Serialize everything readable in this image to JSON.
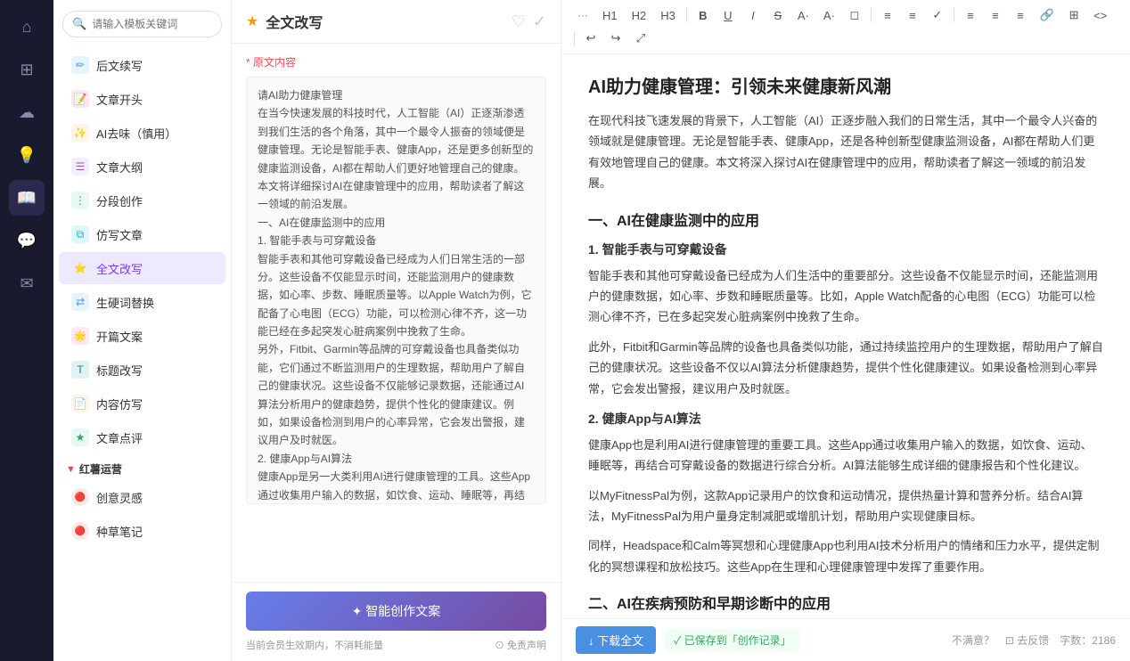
{
  "sidebar": {
    "icons": [
      {
        "name": "home",
        "symbol": "⌂",
        "active": false
      },
      {
        "name": "template",
        "symbol": "⊞",
        "active": false
      },
      {
        "name": "cloud",
        "symbol": "☁",
        "active": false
      },
      {
        "name": "bulb",
        "symbol": "💡",
        "active": false
      },
      {
        "name": "book",
        "symbol": "📖",
        "active": true
      },
      {
        "name": "chat",
        "symbol": "💬",
        "active": false
      },
      {
        "name": "mail",
        "symbol": "✉",
        "active": false
      }
    ]
  },
  "search": {
    "placeholder": "请输入模板关键词"
  },
  "nav_items": [
    {
      "label": "后文续写",
      "color": "dot-blue",
      "active": false
    },
    {
      "label": "文章开头",
      "color": "dot-red",
      "active": false
    },
    {
      "label": "AI去味（慎用）",
      "color": "dot-orange",
      "active": false
    },
    {
      "label": "文章大纲",
      "color": "dot-purple",
      "active": false
    },
    {
      "label": "分段创作",
      "color": "dot-green",
      "active": false
    },
    {
      "label": "仿写文章",
      "color": "dot-cyan",
      "active": false
    },
    {
      "label": "全文改写",
      "color": "dot-purple",
      "active": true
    },
    {
      "label": "生硬词替换",
      "color": "dot-blue",
      "active": false
    },
    {
      "label": "开篇文案",
      "color": "dot-pink",
      "active": false
    },
    {
      "label": "标题改写",
      "color": "dot-teal",
      "active": false
    },
    {
      "label": "内容仿写",
      "color": "dot-orange",
      "active": false
    },
    {
      "label": "文章点评",
      "color": "dot-green",
      "active": false
    }
  ],
  "section": {
    "label": "红薯运营",
    "sub_items": [
      {
        "label": "创意灵感",
        "color": "dot-red"
      },
      {
        "label": "种草笔记",
        "color": "dot-red"
      }
    ]
  },
  "middle": {
    "title": "全文改写",
    "original_label": "* 原文内容",
    "original_text": "请AI助力健康管理\n在当今快速发展的科技时代，人工智能（AI）正逐渐渗透到我们生活的各个角落，其中一个最令人振奋的领域便是健康管理。无论是智能手表、健康App，还是更多创新型的健康监测设备，AI都在帮助人们更好地管理自己的健康。本文将详细探讨AI在健康管理中的应用，帮助读者了解这一领域的前沿发展。\n一、AI在健康监测中的应用\n1. 智能手表与可穿戴设备\n智能手表和其他可穿戴设备已经成为人们日常生活的一部分。这些设备不仅能显示时间，还能监测用户的健康数据，如心率、步数、睡眠质量等。以Apple Watch为例，它配备了心电图（ECG）功能，可以检测心律不齐，这一功能已经在多起突发心脏病案例中挽救了生命。\n另外，Fitbit、Garmin等品牌的可穿戴设备也具备类似功能，它们通过不断监测用户的生理数据，帮助用户了解自己的健康状况。这些设备不仅能够记录数据，还能通过AI算法分析用户的健康趋势，提供个性化的健康建议。例如，如果设备检测到用户的心率异常，它会发出警报，建议用户及时就医。\n2. 健康App与AI算法\n健康App是另一大类利用AI进行健康管理的工具。这些App通过收集用户输入的数据，如饮食、运动、睡眠等，再结合可穿戴设备的数据进行综合分析。AI算法能够分析这些数据，生成详细的健康报告和个性化建议。",
    "smart_btn_label": "✦ 智能创作文案",
    "footer_note_left": "当前会员生效期内，不消耗能量",
    "footer_note_right": "⊙ 免责声明"
  },
  "editor": {
    "title": "AI助力健康管理：引领未来健康新风潮",
    "toolbar": {
      "buttons": [
        "",
        "H1",
        "H2",
        "H3",
        "B",
        "U",
        "I",
        "S",
        "A·",
        "A·",
        "◻",
        "≡",
        "≡",
        "✓"
      ],
      "buttons2": [
        "≡",
        "≡",
        "≡",
        "🔗",
        "⊞",
        "<>",
        "↩",
        "↪",
        "⤢"
      ]
    },
    "sections": [
      {
        "type": "p",
        "text": "在现代科技飞速发展的背景下，人工智能（AI）正逐步融入我们的日常生活，其中一个最令人兴奋的领域就是健康管理。无论是智能手表、健康App，还是各种创新型健康监测设备，AI都在帮助人们更有效地管理自己的健康。本文将深入探讨AI在健康管理中的应用，帮助读者了解这一领域的前沿发展。"
      },
      {
        "type": "h2",
        "text": "一、AI在健康监测中的应用"
      },
      {
        "type": "h3",
        "text": "1. 智能手表与可穿戴设备"
      },
      {
        "type": "p",
        "text": "智能手表和其他可穿戴设备已经成为人们生活中的重要部分。这些设备不仅能显示时间，还能监测用户的健康数据，如心率、步数和睡眠质量等。比如，Apple Watch配备的心电图（ECG）功能可以检测心律不齐，已在多起突发心脏病案例中挽救了生命。"
      },
      {
        "type": "p",
        "text": "此外，Fitbit和Garmin等品牌的设备也具备类似功能，通过持续监控用户的生理数据，帮助用户了解自己的健康状况。这些设备不仅以AI算法分析健康趋势，提供个性化健康建议。如果设备检测到心率异常，它会发出警报，建议用户及时就医。"
      },
      {
        "type": "h3",
        "text": "2. 健康App与AI算法"
      },
      {
        "type": "p",
        "text": "健康App也是利用AI进行健康管理的重要工具。这些App通过收集用户输入的数据，如饮食、运动、睡眠等，再结合可穿戴设备的数据进行综合分析。AI算法能够生成详细的健康报告和个性化建议。"
      },
      {
        "type": "p",
        "text": "以MyFitnessPal为例，这款App记录用户的饮食和运动情况，提供热量计算和营养分析。结合AI算法，MyFitnessPal为用户量身定制减肥或增肌计划，帮助用户实现健康目标。"
      },
      {
        "type": "p",
        "text": "同样，Headspace和Calm等冥想和心理健康App也利用AI技术分析用户的情绪和压力水平，提供定制化的冥想课程和放松技巧。这些App在生理和心理健康管理中发挥了重要作用。"
      },
      {
        "type": "h2",
        "text": "二、AI在疾病预防和早期诊断中的应用"
      }
    ],
    "download_btn": "↓ 下载全文",
    "saved_text": "✓ 已保存到「创作记录」",
    "unsatisfied": "不满意？",
    "feedback": "⊡ 去反馈",
    "word_count_label": "字数：",
    "word_count": "2186"
  }
}
